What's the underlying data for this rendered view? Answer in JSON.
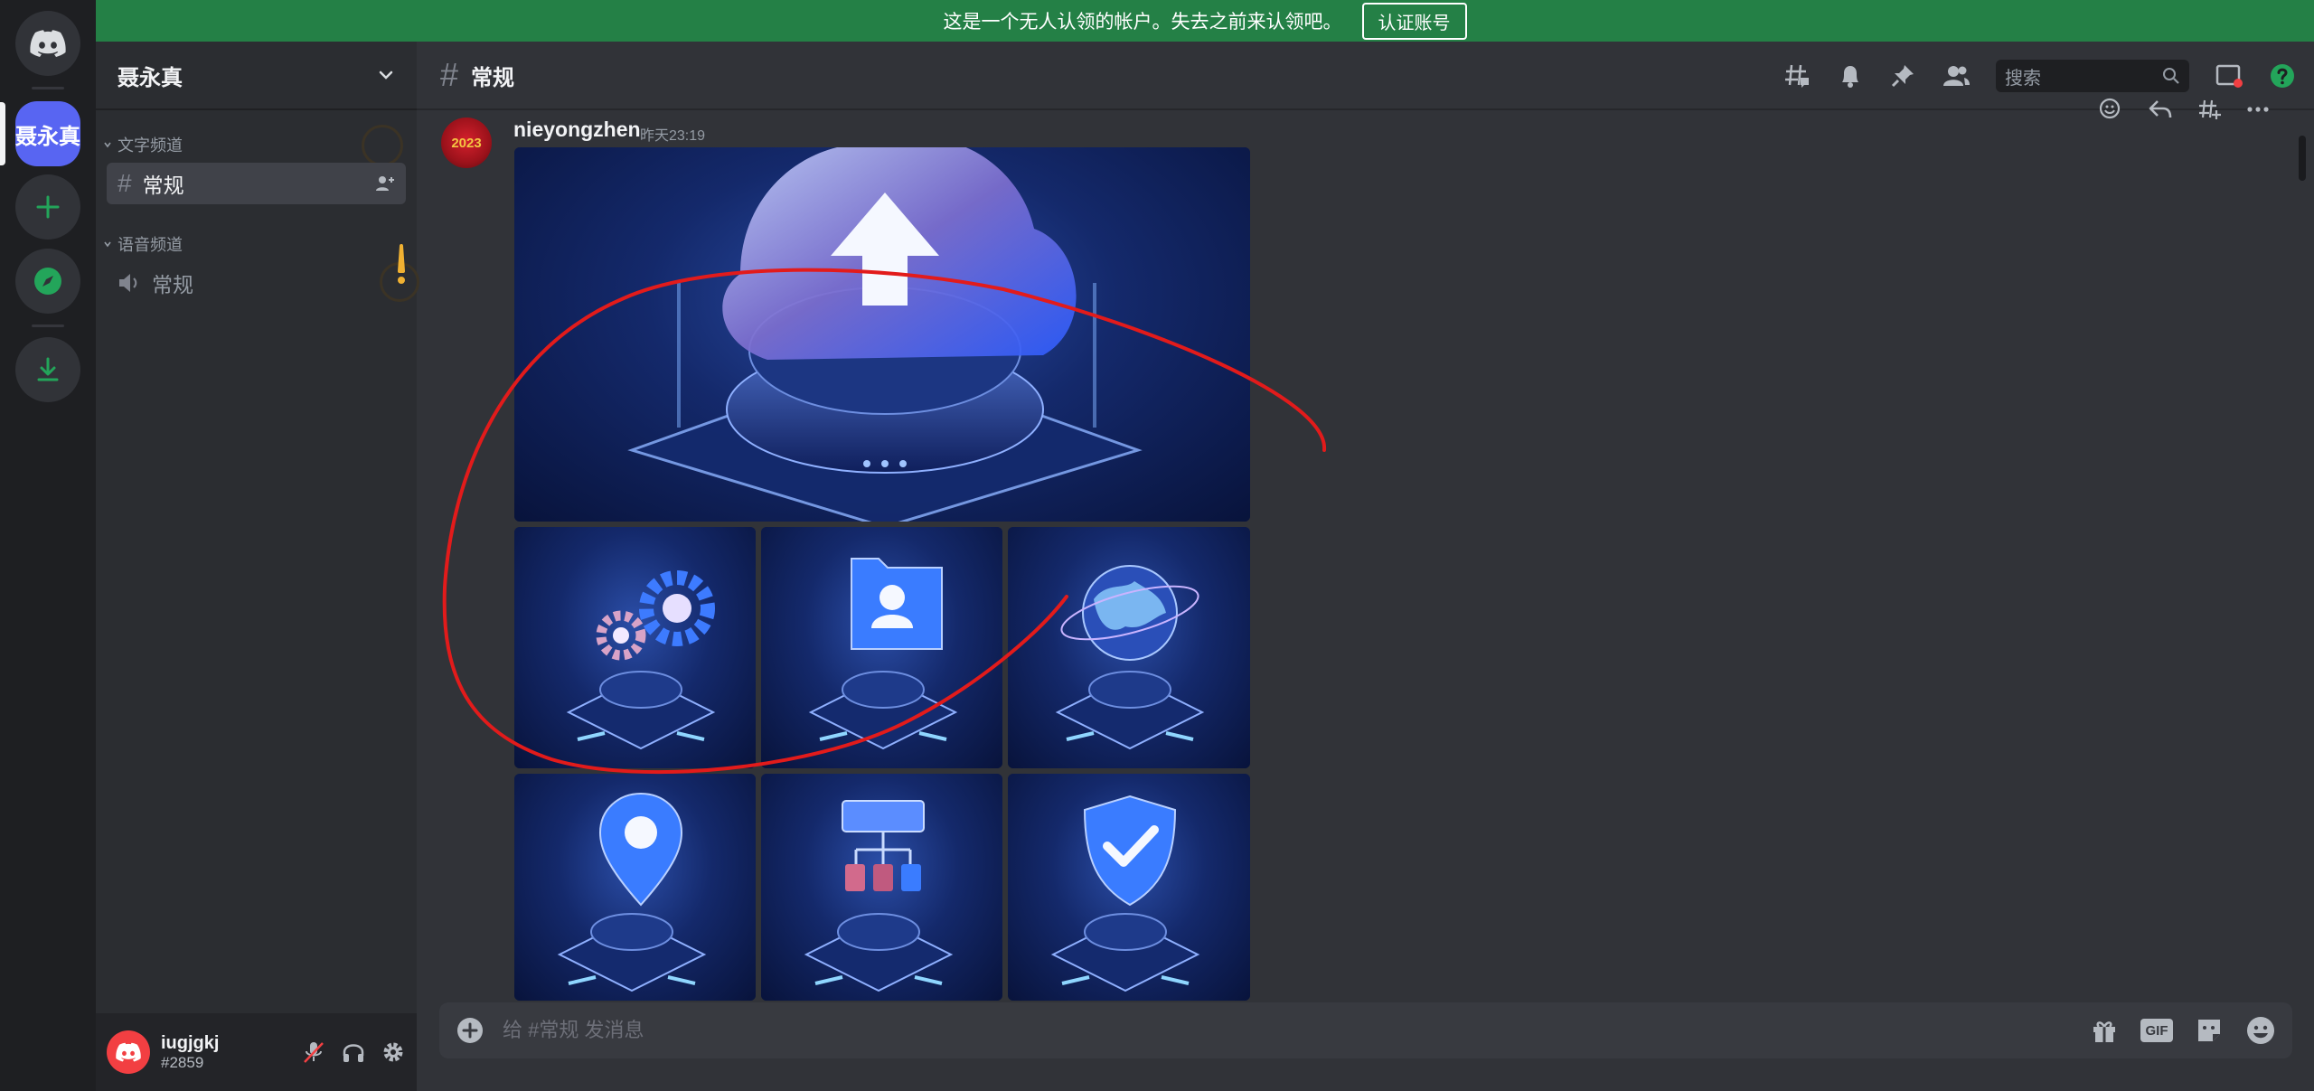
{
  "banner": {
    "text": "这是一个无人认领的帐户。失去之前来认领吧。",
    "button_label": "认证账号"
  },
  "guilds": {
    "active_label": "聂永真"
  },
  "server": {
    "name": "聂永真",
    "categories": [
      {
        "label": "文字频道",
        "channels": [
          {
            "name": "常规",
            "type": "text"
          }
        ]
      },
      {
        "label": "语音频道",
        "channels": [
          {
            "name": "常规",
            "type": "voice"
          }
        ]
      }
    ]
  },
  "user": {
    "name": "iugjgkj",
    "tag": "#2859"
  },
  "header": {
    "channel_name": "常规",
    "search_placeholder": "搜索"
  },
  "message": {
    "author": "nieyongzhen",
    "timestamp": "昨天23:19",
    "avatar_text": "2023",
    "attachments": [
      {
        "icon": "cloud-upload-icon"
      },
      {
        "icon": "gears-icon"
      },
      {
        "icon": "user-folder-icon"
      },
      {
        "icon": "globe-icon"
      },
      {
        "icon": "location-pin-icon"
      },
      {
        "icon": "sitemap-icon"
      },
      {
        "icon": "shield-check-icon"
      }
    ]
  },
  "composer": {
    "placeholder": "给 #常规 发消息",
    "gif_label": "GIF"
  },
  "colors": {
    "blurple": "#5865f2",
    "banner_green": "#248046",
    "annotation_red": "#e21b1b",
    "warning_yellow": "#f0b132",
    "green_icon": "#23a55a"
  }
}
